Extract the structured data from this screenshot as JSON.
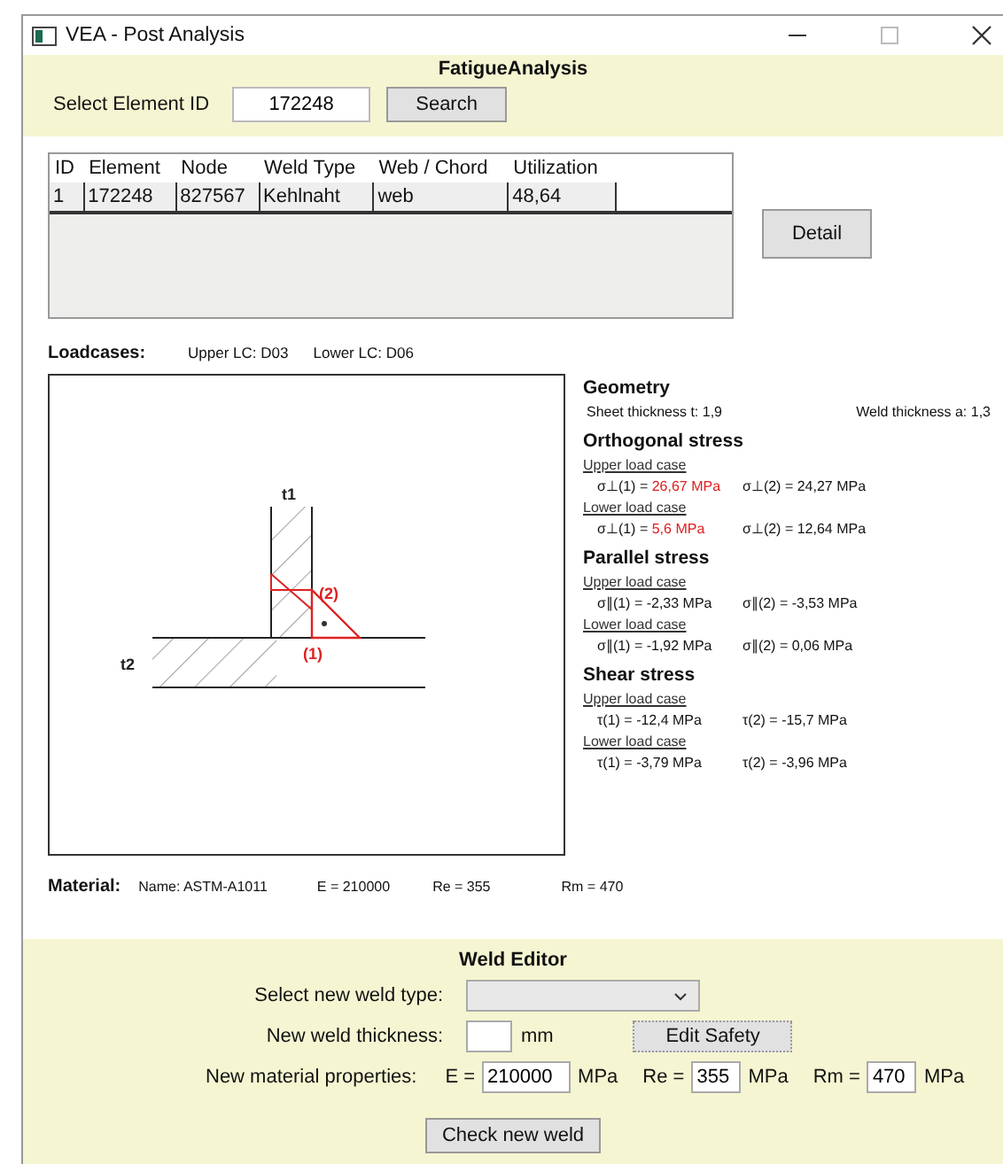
{
  "window": {
    "title": "VEA - Post Analysis"
  },
  "header": {
    "title": "FatigueAnalysis",
    "select_label": "Select Element ID",
    "element_id": "172248",
    "search_button": "Search"
  },
  "table": {
    "columns": [
      "ID",
      "Element",
      "Node",
      "Weld Type",
      "Web / Chord",
      "Utilization"
    ],
    "rows": [
      {
        "cells": [
          "1",
          "172248",
          "827567",
          "Kehlnaht",
          "web",
          "48,64"
        ],
        "selected": false
      }
    ]
  },
  "detail_button": "Detail",
  "loadcases": {
    "label": "Loadcases:",
    "upper": "Upper LC:  D03",
    "lower": "Lower LC:  D06"
  },
  "diagram": {
    "labels": [
      "t1",
      "t2",
      "(1)",
      "(2)"
    ]
  },
  "geometry": {
    "title": "Geometry",
    "sheet": "Sheet thickness t:  1,9",
    "weld": "Weld thickness a:  1,3"
  },
  "stress_sections": [
    {
      "title": "Orthogonal stress",
      "cases": [
        {
          "label": "Upper load case",
          "values": [
            {
              "label": "σ⊥(1) =",
              "value": "26,67 MPa",
              "critical": true
            },
            {
              "label": "σ⊥(2) =",
              "value": "24,27 MPa",
              "critical": false
            }
          ]
        },
        {
          "label": "Lower load case",
          "values": [
            {
              "label": "σ⊥(1) =",
              "value": "5,6 MPa",
              "critical": true
            },
            {
              "label": "σ⊥(2) =",
              "value": "12,64 MPa",
              "critical": false
            }
          ]
        }
      ]
    },
    {
      "title": "Parallel stress",
      "cases": [
        {
          "label": "Upper load case",
          "values": [
            {
              "label": "σ∥(1) =",
              "value": "-2,33 MPa",
              "critical": false
            },
            {
              "label": "σ∥(2) =",
              "value": "-3,53 MPa",
              "critical": false
            }
          ]
        },
        {
          "label": "Lower load case",
          "values": [
            {
              "label": "σ∥(1) =",
              "value": "-1,92 MPa",
              "critical": false
            },
            {
              "label": "σ∥(2) =",
              "value": "0,06 MPa",
              "critical": false
            }
          ]
        }
      ]
    },
    {
      "title": "Shear stress",
      "cases": [
        {
          "label": "Upper load case",
          "values": [
            {
              "label": "τ(1) =",
              "value": "-12,4 MPa",
              "critical": false
            },
            {
              "label": "τ(2) =",
              "value": "-15,7 MPa",
              "critical": false
            }
          ]
        },
        {
          "label": "Lower load case",
          "values": [
            {
              "label": "τ(1) =",
              "value": "-3,79 MPa",
              "critical": false
            },
            {
              "label": "τ(2) =",
              "value": "-3,96 MPa",
              "critical": false
            }
          ]
        }
      ]
    }
  ],
  "material": {
    "label": "Material:",
    "name": "Name:  ASTM-A1011",
    "e": "E = 210000",
    "re": "Re = 355",
    "rm": "Rm = 470"
  },
  "weld_editor": {
    "title": "Weld Editor",
    "type_label": "Select new weld type:",
    "thickness_label": "New weld thickness:",
    "thickness_unit": "mm",
    "edit_safety_button": "Edit Safety",
    "material_label": "New material properties:",
    "properties": [
      {
        "label": "E =",
        "value": "210000",
        "unit": "MPa"
      },
      {
        "label": "Re =",
        "value": "355",
        "unit": "MPa"
      },
      {
        "label": "Rm =",
        "value": "470",
        "unit": "MPa"
      }
    ],
    "check_button": "Check new weld"
  }
}
